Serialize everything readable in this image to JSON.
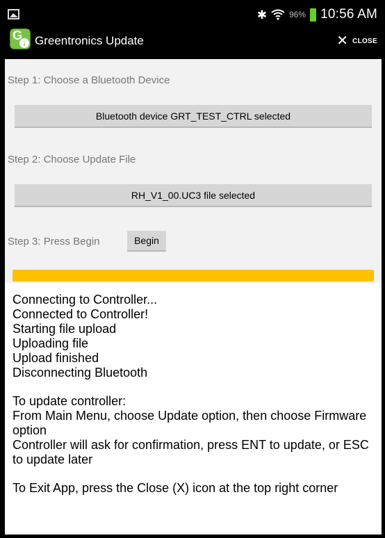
{
  "status_bar": {
    "battery_percent": "96%",
    "time": "10:56 AM",
    "battery_color": "#6acd2a",
    "icons": [
      "photo-icon",
      "bluetooth-icon",
      "wifi-icon",
      "battery-icon"
    ]
  },
  "action_bar": {
    "app_title": "Greentronics Update",
    "logo_letter": "G",
    "close_label": "CLOSE"
  },
  "steps": {
    "step1_label": "Step 1: Choose a Bluetooth Device",
    "step1_button": "Bluetooth device GRT_TEST_CTRL selected",
    "step2_label": "Step 2: Choose Update File",
    "step2_button": "RH_V1_00.UC3 file selected",
    "step3_label": "Step 3: Press Begin",
    "begin_button": "Begin"
  },
  "progress": {
    "fraction": 1.0,
    "color": "#ffc000"
  },
  "log": {
    "lines": [
      "Connecting to Controller...",
      "Connected to Controller!",
      "Starting file upload",
      "Uploading file",
      "Upload finished",
      "Disconnecting Bluetooth"
    ],
    "instructions": [
      "To update controller:",
      "From Main Menu, choose Update option, then choose Firmware option",
      "Controller will ask for confirmation, press ENT to update, or ESC to update later"
    ],
    "exit_note": "To Exit App, press the Close (X) icon at the top right corner"
  }
}
